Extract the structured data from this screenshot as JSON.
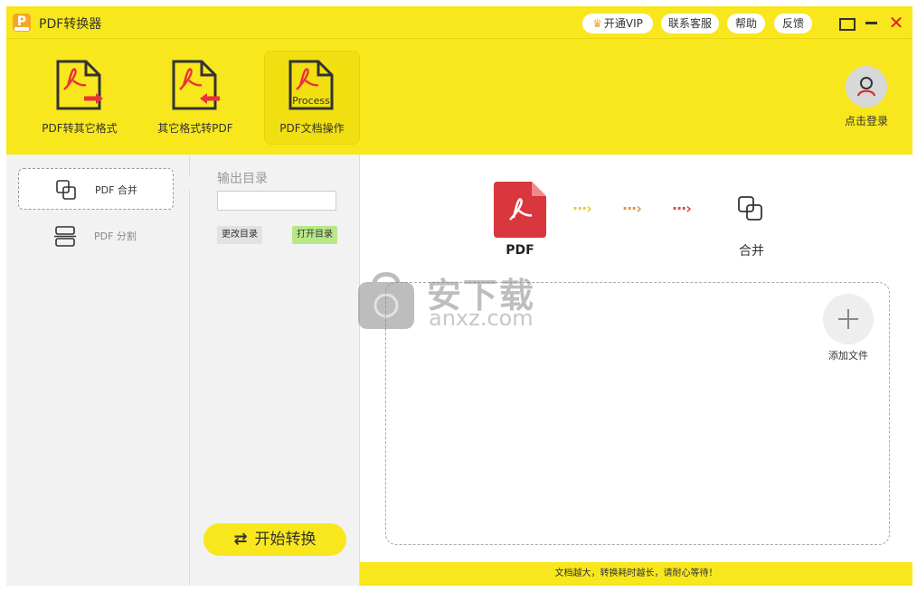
{
  "app": {
    "title": "PDF转换器",
    "logo_letter": "P"
  },
  "titlebar": {
    "vip_label": "开通VIP",
    "service_label": "联系客服",
    "help_label": "帮助",
    "feedback_label": "反馈"
  },
  "toolbar": {
    "tools": [
      {
        "label": "PDF转其它格式"
      },
      {
        "label": "其它格式转PDF"
      },
      {
        "label": "PDF文档操作",
        "badge": "Process"
      }
    ],
    "login_label": "点击登录"
  },
  "sidebar": {
    "items": [
      {
        "label": "PDF 合并"
      },
      {
        "label": "PDF 分割"
      }
    ]
  },
  "output": {
    "label": "输出目录",
    "path_value": "",
    "change_dir_label": "更改目录",
    "open_dir_label": "打开目录"
  },
  "start_button": {
    "label": "开始转换"
  },
  "flow": {
    "source_label": "PDF",
    "target_label": "合并"
  },
  "dropzone": {
    "add_label": "添加文件"
  },
  "footer": {
    "message": "文档越大，转换耗时越长，请耐心等待！"
  },
  "watermark": {
    "text": "安下载",
    "url": "anxz.com"
  },
  "colors": {
    "brand_yellow": "#f8e71c",
    "pdf_red": "#d9363e",
    "close_red": "#e02020",
    "open_dir_green": "#b7e887"
  }
}
